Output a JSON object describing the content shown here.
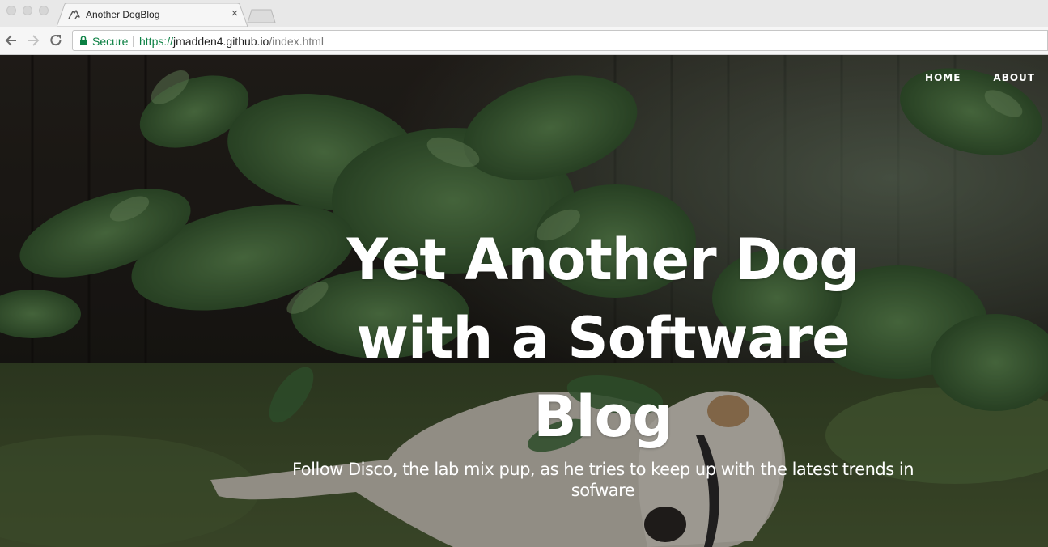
{
  "browser": {
    "tab_title": "Another DogBlog",
    "tab_close_glyph": "×",
    "security_label": "Secure",
    "url": {
      "scheme": "https://",
      "host": "jmadden4.github.io",
      "path": "/index.html"
    },
    "icons": {
      "favicon": "dog-favicon-icon",
      "back": "back-arrow-icon",
      "forward": "forward-arrow-icon",
      "reload": "reload-icon",
      "lock": "lock-icon"
    },
    "colors": {
      "secure_green": "#0b8043"
    }
  },
  "site": {
    "nav": [
      {
        "label": "Home"
      },
      {
        "label": "About"
      }
    ],
    "heading": "Yet Another Dog with a Software Blog",
    "subheading": "Follow Disco, the lab mix pup, as he tries to keep up with the latest trends in sofware"
  }
}
